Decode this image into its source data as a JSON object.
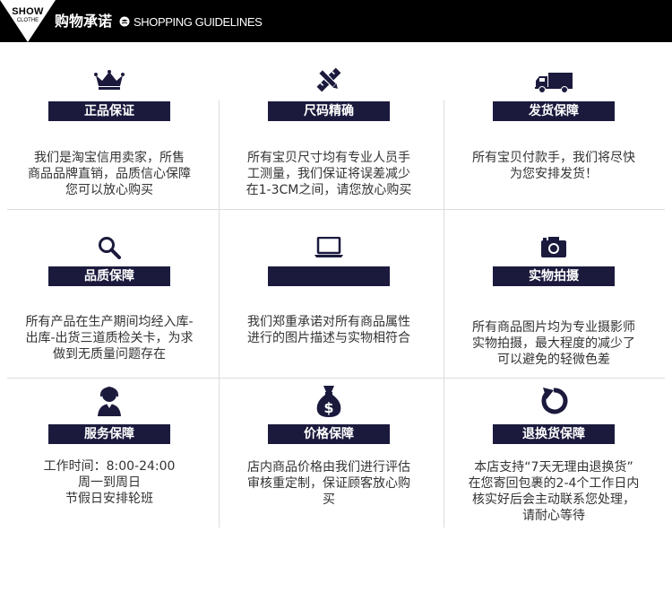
{
  "header": {
    "logo_top": "SHOW",
    "logo_bottom": "CLOTHE",
    "title": "购物承诺",
    "subtitle": "SHOPPING GUIDELINES"
  },
  "colors": {
    "header_bg": "#000000",
    "label_bg": "#1b1a3d",
    "icon": "#1b1a3d"
  },
  "cells": [
    {
      "icon": "crown-icon",
      "label": "正品保证",
      "lines": [
        "我们是淘宝信用卖家，所售",
        "商品品牌直销，品质信心保障",
        "您可以放心购买"
      ]
    },
    {
      "icon": "ruler-pencil-icon",
      "label": "尺码精确",
      "lines": [
        "所有宝贝尺寸均有专业人员手",
        "工测量，我们保证将误差减少",
        "在1-3CM之间，请您放心购买"
      ]
    },
    {
      "icon": "truck-icon",
      "label": "发货保障",
      "lines": [
        "所有宝贝付款手，我们将尽快",
        "为您安排发货！"
      ]
    },
    {
      "icon": "magnifier-icon",
      "label": "品质保障",
      "lines": [
        "所有产品在生产期间均经入库-",
        "出库-出货三道质检关卡，为求",
        "做到无质量问题存在"
      ]
    },
    {
      "icon": "laptop-icon",
      "label": "",
      "lines": [
        "我们郑重承诺对所有商品属性",
        "进行的图片描述与实物相符合"
      ]
    },
    {
      "icon": "camera-icon",
      "label": "实物拍摄",
      "lines": [
        "所有商品图片均为专业摄影师",
        "实物拍摄，最大程度的减少了",
        "可以避免的轻微色差"
      ]
    },
    {
      "icon": "customer-service-icon",
      "label": "服务保障",
      "lines": [
        "工作时间：8:00-24:00",
        "周一到周日",
        "节假日安排轮班"
      ]
    },
    {
      "icon": "money-bag-icon",
      "label": "价格保障",
      "lines": [
        "店内商品价格由我们进行评估",
        "审核重定制，保证顾客放心购",
        "买"
      ]
    },
    {
      "icon": "return-arrow-icon",
      "label": "退换货保障",
      "lines": [
        "本店支持“7天无理由退换货”",
        "在您寄回包裹的2-4个工作日内",
        "核实好后会主动联系您处理，",
        "请耐心等待"
      ]
    }
  ]
}
